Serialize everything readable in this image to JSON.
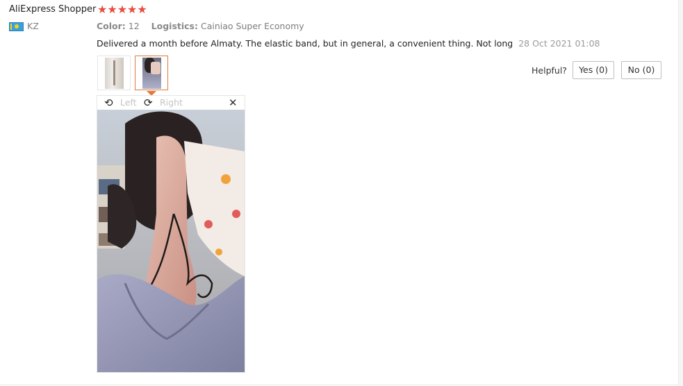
{
  "review": {
    "user_name": "AliExpress Shopper",
    "stars": "★★★★★",
    "rating": 5,
    "country": "KZ",
    "color_label": "Color:",
    "color_value": "12",
    "logistics_label": "Logistics:",
    "logistics_value": "Cainiao Super Economy",
    "text": "Delivered a month before Almaty. The elastic band, but in general, a convenient thing. Not long",
    "date": "28 Oct 2021 01:08"
  },
  "feedback": {
    "helpful_label": "Helpful?",
    "yes_label": "Yes (0)",
    "no_label": "No (0)"
  },
  "viewer": {
    "rotate_left_label": "Left",
    "rotate_right_label": "Right",
    "icons": [
      "rotate-left-icon",
      "rotate-right-icon",
      "close-icon"
    ]
  },
  "colors": {
    "star": "#e94c3d",
    "selected_thumb": "#e07a3a",
    "muted_text": "#7d7d7d"
  }
}
